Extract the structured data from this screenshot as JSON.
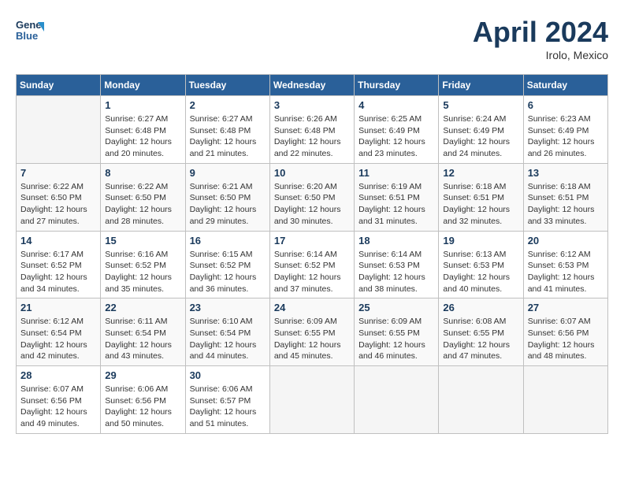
{
  "header": {
    "logo_line1": "General",
    "logo_line2": "Blue",
    "month_year": "April 2024",
    "location": "Irolo, Mexico"
  },
  "weekdays": [
    "Sunday",
    "Monday",
    "Tuesday",
    "Wednesday",
    "Thursday",
    "Friday",
    "Saturday"
  ],
  "weeks": [
    [
      {
        "day": "",
        "info": ""
      },
      {
        "day": "1",
        "info": "Sunrise: 6:27 AM\nSunset: 6:48 PM\nDaylight: 12 hours\nand 20 minutes."
      },
      {
        "day": "2",
        "info": "Sunrise: 6:27 AM\nSunset: 6:48 PM\nDaylight: 12 hours\nand 21 minutes."
      },
      {
        "day": "3",
        "info": "Sunrise: 6:26 AM\nSunset: 6:48 PM\nDaylight: 12 hours\nand 22 minutes."
      },
      {
        "day": "4",
        "info": "Sunrise: 6:25 AM\nSunset: 6:49 PM\nDaylight: 12 hours\nand 23 minutes."
      },
      {
        "day": "5",
        "info": "Sunrise: 6:24 AM\nSunset: 6:49 PM\nDaylight: 12 hours\nand 24 minutes."
      },
      {
        "day": "6",
        "info": "Sunrise: 6:23 AM\nSunset: 6:49 PM\nDaylight: 12 hours\nand 26 minutes."
      }
    ],
    [
      {
        "day": "7",
        "info": "Sunrise: 6:22 AM\nSunset: 6:50 PM\nDaylight: 12 hours\nand 27 minutes."
      },
      {
        "day": "8",
        "info": "Sunrise: 6:22 AM\nSunset: 6:50 PM\nDaylight: 12 hours\nand 28 minutes."
      },
      {
        "day": "9",
        "info": "Sunrise: 6:21 AM\nSunset: 6:50 PM\nDaylight: 12 hours\nand 29 minutes."
      },
      {
        "day": "10",
        "info": "Sunrise: 6:20 AM\nSunset: 6:50 PM\nDaylight: 12 hours\nand 30 minutes."
      },
      {
        "day": "11",
        "info": "Sunrise: 6:19 AM\nSunset: 6:51 PM\nDaylight: 12 hours\nand 31 minutes."
      },
      {
        "day": "12",
        "info": "Sunrise: 6:18 AM\nSunset: 6:51 PM\nDaylight: 12 hours\nand 32 minutes."
      },
      {
        "day": "13",
        "info": "Sunrise: 6:18 AM\nSunset: 6:51 PM\nDaylight: 12 hours\nand 33 minutes."
      }
    ],
    [
      {
        "day": "14",
        "info": "Sunrise: 6:17 AM\nSunset: 6:52 PM\nDaylight: 12 hours\nand 34 minutes."
      },
      {
        "day": "15",
        "info": "Sunrise: 6:16 AM\nSunset: 6:52 PM\nDaylight: 12 hours\nand 35 minutes."
      },
      {
        "day": "16",
        "info": "Sunrise: 6:15 AM\nSunset: 6:52 PM\nDaylight: 12 hours\nand 36 minutes."
      },
      {
        "day": "17",
        "info": "Sunrise: 6:14 AM\nSunset: 6:52 PM\nDaylight: 12 hours\nand 37 minutes."
      },
      {
        "day": "18",
        "info": "Sunrise: 6:14 AM\nSunset: 6:53 PM\nDaylight: 12 hours\nand 38 minutes."
      },
      {
        "day": "19",
        "info": "Sunrise: 6:13 AM\nSunset: 6:53 PM\nDaylight: 12 hours\nand 40 minutes."
      },
      {
        "day": "20",
        "info": "Sunrise: 6:12 AM\nSunset: 6:53 PM\nDaylight: 12 hours\nand 41 minutes."
      }
    ],
    [
      {
        "day": "21",
        "info": "Sunrise: 6:12 AM\nSunset: 6:54 PM\nDaylight: 12 hours\nand 42 minutes."
      },
      {
        "day": "22",
        "info": "Sunrise: 6:11 AM\nSunset: 6:54 PM\nDaylight: 12 hours\nand 43 minutes."
      },
      {
        "day": "23",
        "info": "Sunrise: 6:10 AM\nSunset: 6:54 PM\nDaylight: 12 hours\nand 44 minutes."
      },
      {
        "day": "24",
        "info": "Sunrise: 6:09 AM\nSunset: 6:55 PM\nDaylight: 12 hours\nand 45 minutes."
      },
      {
        "day": "25",
        "info": "Sunrise: 6:09 AM\nSunset: 6:55 PM\nDaylight: 12 hours\nand 46 minutes."
      },
      {
        "day": "26",
        "info": "Sunrise: 6:08 AM\nSunset: 6:55 PM\nDaylight: 12 hours\nand 47 minutes."
      },
      {
        "day": "27",
        "info": "Sunrise: 6:07 AM\nSunset: 6:56 PM\nDaylight: 12 hours\nand 48 minutes."
      }
    ],
    [
      {
        "day": "28",
        "info": "Sunrise: 6:07 AM\nSunset: 6:56 PM\nDaylight: 12 hours\nand 49 minutes."
      },
      {
        "day": "29",
        "info": "Sunrise: 6:06 AM\nSunset: 6:56 PM\nDaylight: 12 hours\nand 50 minutes."
      },
      {
        "day": "30",
        "info": "Sunrise: 6:06 AM\nSunset: 6:57 PM\nDaylight: 12 hours\nand 51 minutes."
      },
      {
        "day": "",
        "info": ""
      },
      {
        "day": "",
        "info": ""
      },
      {
        "day": "",
        "info": ""
      },
      {
        "day": "",
        "info": ""
      }
    ]
  ]
}
